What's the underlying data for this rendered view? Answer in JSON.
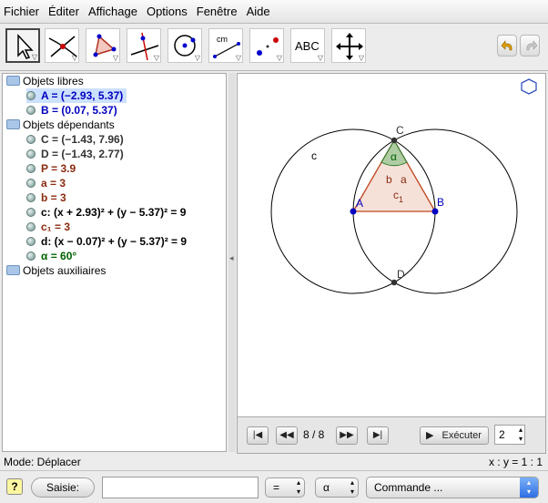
{
  "menu": [
    "Fichier",
    "Éditer",
    "Affichage",
    "Options",
    "Fenêtre",
    "Aide"
  ],
  "toolbar": {
    "tools": [
      {
        "name": "move-tool-icon"
      },
      {
        "name": "intersect-lines-tool-icon"
      },
      {
        "name": "polygon-tool-icon"
      },
      {
        "name": "perpendicular-line-tool-icon"
      },
      {
        "name": "circle-tool-icon"
      },
      {
        "name": "distance-tool-icon",
        "label": "cm"
      },
      {
        "name": "reflect-tool-icon"
      },
      {
        "name": "text-tool-icon",
        "label": "ABC"
      },
      {
        "name": "move-view-tool-icon"
      }
    ]
  },
  "algebra": {
    "free_header": "Objets libres",
    "free": [
      {
        "text": "A = (−2.93, 5.37)",
        "color": "blue"
      },
      {
        "text": "B = (0.07, 5.37)",
        "color": "blue"
      }
    ],
    "dependent_header": "Objets dépendants",
    "dependent": [
      {
        "text": "C = (−1.43, 7.96)",
        "color": "dark"
      },
      {
        "text": "D = (−1.43, 2.77)",
        "color": "dark"
      },
      {
        "text": "P = 3.9",
        "color": "brown"
      },
      {
        "text": "a = 3",
        "color": "brown"
      },
      {
        "text": "b = 3",
        "color": "brown"
      },
      {
        "text": "c: (x + 2.93)² + (y − 5.37)² = 9",
        "color": "blk"
      },
      {
        "text": "c₁ = 3",
        "color": "brown"
      },
      {
        "text": "d: (x − 0.07)² + (y − 5.37)² = 9",
        "color": "blk"
      },
      {
        "text": "α = 60°",
        "color": "green"
      }
    ],
    "aux_header": "Objets auxiliaires"
  },
  "graphics": {
    "label_A": "A",
    "label_B": "B",
    "label_C": "C",
    "label_D": "D",
    "label_c": "c",
    "label_alpha": "α",
    "label_b": "b",
    "label_a": "a",
    "label_c1": "c",
    "label_c1_sub": "1"
  },
  "navigation": {
    "step": "8 / 8",
    "play_label": "Exécuter",
    "speed_value": "2"
  },
  "status": {
    "mode": "Mode: Déplacer",
    "ratio": "x : y = 1 : 1"
  },
  "inputbar": {
    "input_label": "Saisie:",
    "input_value": "",
    "equals": "=",
    "alpha": "α",
    "command_placeholder": "Commande ..."
  },
  "colors": {
    "point_blue": "#0000c0",
    "triangle_fill": "#f5dcd2",
    "triangle_stroke": "#c0451e",
    "angle_fill": "#7fbf7f"
  }
}
